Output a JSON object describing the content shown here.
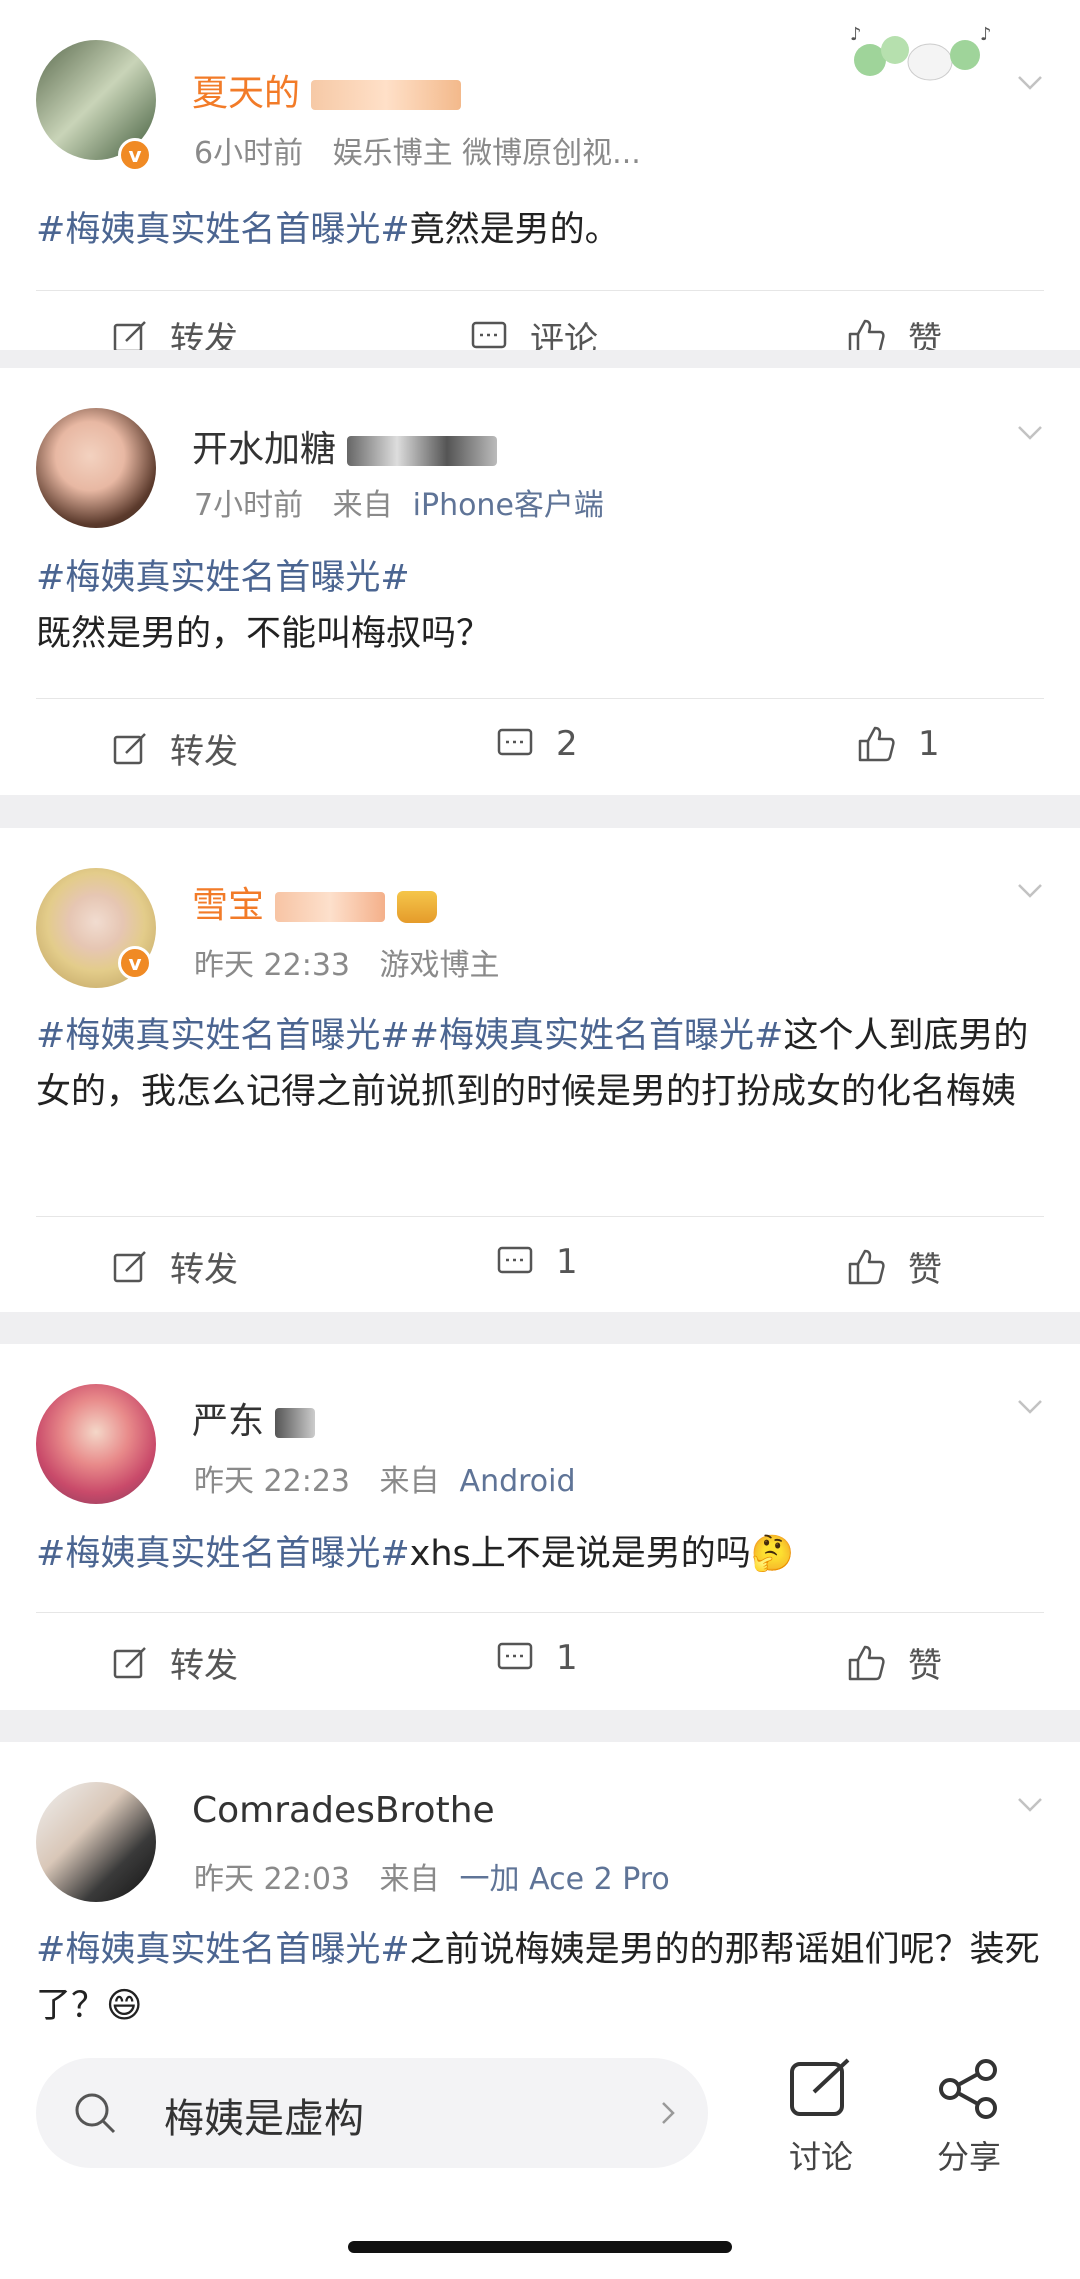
{
  "posts": [
    {
      "username": "夏天的",
      "meta": {
        "time": "6小时前",
        "source": "娱乐博主 微博原创视..."
      },
      "content": {
        "tag": "#梅姨真实姓名首曝光#",
        "text": "竟然是男的。"
      },
      "actions": {
        "repost": "转发",
        "comment": "评论",
        "like": "赞"
      }
    },
    {
      "username": "开水加糖",
      "meta": {
        "time": "7小时前",
        "source_prefix": "来自",
        "source": "iPhone客户端"
      },
      "content": {
        "tag": "#梅姨真实姓名首曝光#",
        "text": "既然是男的，不能叫梅叔吗？"
      },
      "actions": {
        "repost": "转发",
        "comment": "2",
        "like": "1"
      }
    },
    {
      "username": "雪宝",
      "meta": {
        "time": "昨天 22:33",
        "source": "游戏博主"
      },
      "content": {
        "tag1": "#梅姨真实姓名首曝光#",
        "tag2": "#梅姨真实姓名首曝光#",
        "text": "这个人到底男的女的，我怎么记得之前说抓到的时候是男的打扮成女的化名梅姨"
      },
      "actions": {
        "repost": "转发",
        "comment": "1",
        "like": "赞"
      }
    },
    {
      "username": "严东",
      "meta": {
        "time": "昨天 22:23",
        "source_prefix": "来自",
        "source": "Android"
      },
      "content": {
        "tag": "#梅姨真实姓名首曝光#",
        "text": "xhs上不是说是男的吗",
        "emoji": "🤔"
      },
      "actions": {
        "repost": "转发",
        "comment": "1",
        "like": "赞"
      }
    },
    {
      "username": "ComradesBrothe",
      "meta": {
        "time": "昨天 22:03",
        "source_prefix": "来自",
        "source": "一加 Ace 2 Pro"
      },
      "content": {
        "tag": "#梅姨真实姓名首曝光#",
        "text": "之前说梅姨是男的的那帮谣姐们呢？装死了？",
        "emoji": "😄"
      }
    }
  ],
  "bottom_bar": {
    "search_text": "梅姨是虚构",
    "discuss_label": "讨论",
    "share_label": "分享"
  },
  "colors": {
    "tag": "#4b6591",
    "badge": "#f08a24",
    "username_orange": "#f27b28"
  }
}
